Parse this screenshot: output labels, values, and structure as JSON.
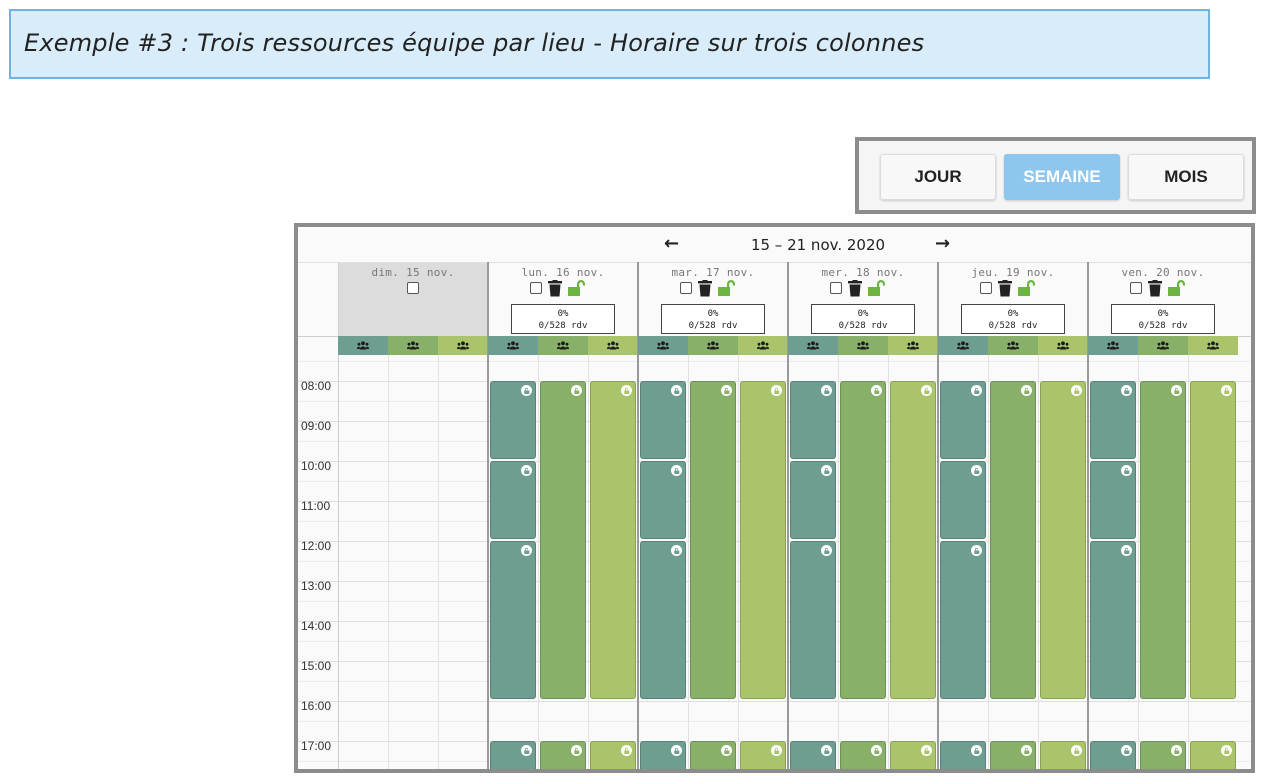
{
  "header": {
    "title": "Exemple #3 : Trois ressources équipe par lieu - Horaire sur trois colonnes"
  },
  "view_switcher": {
    "buttons": [
      {
        "label": "JOUR",
        "active": false
      },
      {
        "label": "SEMAINE",
        "active": true
      },
      {
        "label": "MOIS",
        "active": false
      }
    ]
  },
  "calendar": {
    "range_label": "15 – 21 nov. 2020",
    "prev_icon": "arrow-left-icon",
    "next_icon": "arrow-right-icon",
    "days": [
      {
        "label": "dim. 15 nov.",
        "disabled": true,
        "percent": "",
        "rdv": ""
      },
      {
        "label": "lun. 16 nov.",
        "disabled": false,
        "percent": "0%",
        "rdv": "0/528 rdv"
      },
      {
        "label": "mar. 17 nov.",
        "disabled": false,
        "percent": "0%",
        "rdv": "0/528 rdv"
      },
      {
        "label": "mer. 18 nov.",
        "disabled": false,
        "percent": "0%",
        "rdv": "0/528 rdv"
      },
      {
        "label": "jeu. 19 nov.",
        "disabled": false,
        "percent": "0%",
        "rdv": "0/528 rdv"
      },
      {
        "label": "ven. 20 nov.",
        "disabled": false,
        "percent": "0%",
        "rdv": "0/528 rdv"
      }
    ],
    "resource_icon": "team-icon",
    "times": [
      "08:00",
      "09:00",
      "10:00",
      "11:00",
      "12:00",
      "13:00",
      "14:00",
      "15:00",
      "16:00",
      "17:00"
    ],
    "colors": {
      "resource_1": "#6e9d92",
      "resource_2": "#88b068",
      "resource_3": "#aac46b",
      "lock_icon": "#6cb33f",
      "active_button": "#8ec6ee"
    }
  }
}
